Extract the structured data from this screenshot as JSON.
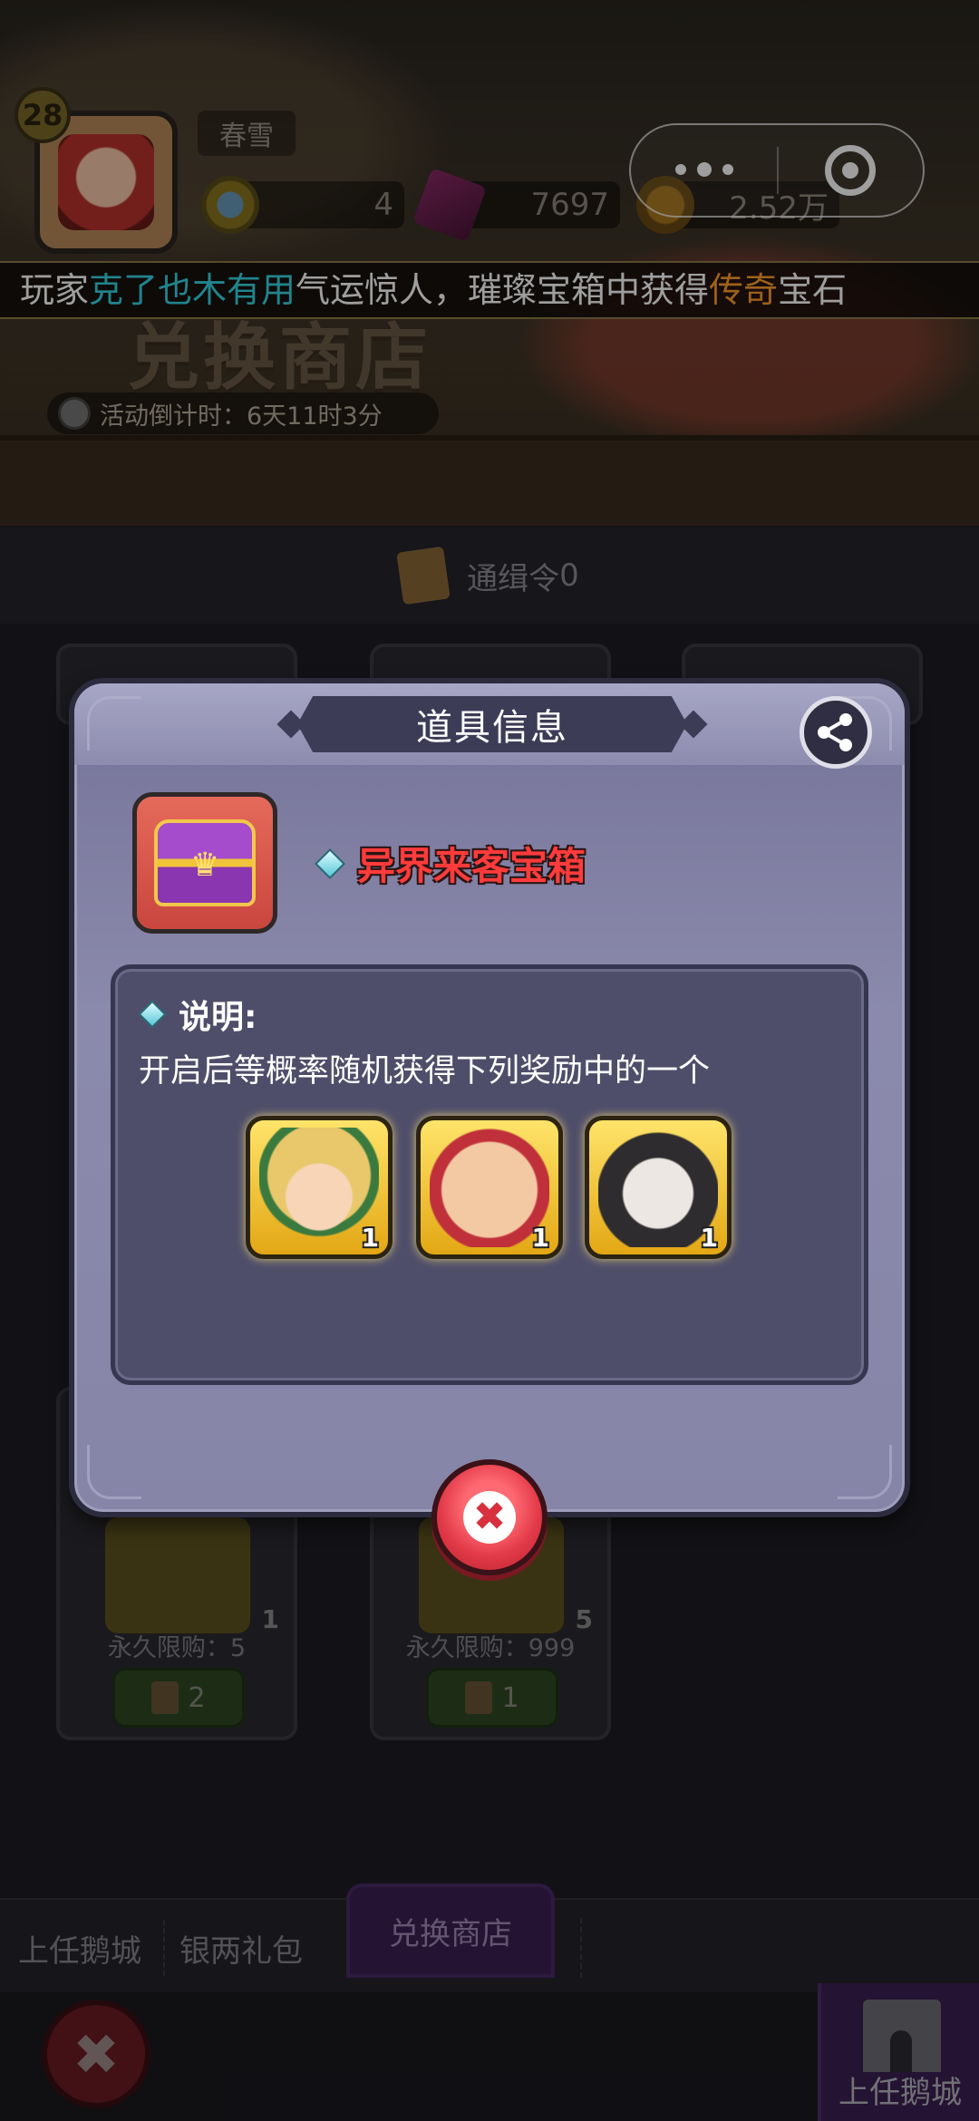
{
  "player": {
    "level": "28",
    "name": "春雪",
    "resource_coins": "4",
    "resource_gems": "7697",
    "resource_gold": "2.52万"
  },
  "marquee": {
    "prefix": "玩家",
    "player_name": "克了也木有用",
    "middle": "气运惊人，璀璨宝箱中获得",
    "rarity": "传奇",
    "suffix": "宝石"
  },
  "shop": {
    "title": "兑换商店",
    "countdown": "活动倒计时：6天11时3分",
    "token_label": "通缉令",
    "token_count": "0",
    "cards": [
      {
        "qty": "1",
        "limit": "永久限购：5",
        "price": "2"
      },
      {
        "qty": "5",
        "limit": "永久限购：999",
        "price": "1"
      }
    ]
  },
  "tabs": {
    "tab1": "上任鹅城",
    "tab2": "银两礼包",
    "tab3": "兑换商店"
  },
  "bottom": {
    "castle_label": "上任鹅城"
  },
  "modal": {
    "title": "道具信息",
    "item_name": "异界来客宝箱",
    "desc_label": "说明:",
    "desc_text": "开启后等概率随机获得下列奖励中的一个",
    "rewards": [
      {
        "icon": "elf-hero-portrait",
        "count": "1"
      },
      {
        "icon": "monk-hero-portrait",
        "count": "1"
      },
      {
        "icon": "swordsman-hero-portrait",
        "count": "1"
      }
    ]
  },
  "icons": {
    "share": "share-icon",
    "close": "close-icon",
    "chest": "treasure-chest-icon"
  },
  "colors": {
    "item_name": "#ff3b3b",
    "marquee_player": "#36d6e4",
    "marquee_rarity": "#ff9d2a",
    "modal_bg": "#8685a8",
    "close_button": "#e23a48"
  }
}
